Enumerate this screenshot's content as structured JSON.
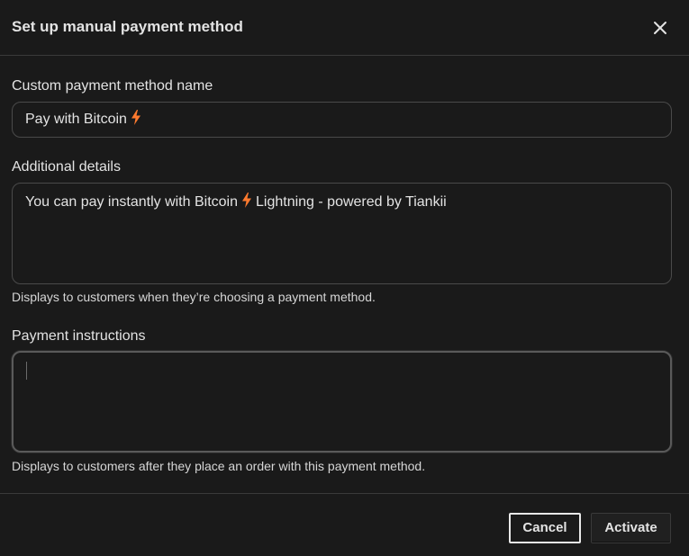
{
  "dialog": {
    "title": "Set up manual payment method",
    "close_icon": "close-icon"
  },
  "name_field": {
    "label": "Custom payment method name",
    "value_prefix": "Pay with Bitcoin",
    "icon": "lightning-bolt-icon"
  },
  "details_field": {
    "label": "Additional details",
    "value_before": "You can pay instantly with Bitcoin",
    "value_after": "Lightning - powered by Tiankii",
    "icon": "lightning-bolt-icon",
    "help": "Displays to customers when they’re choosing a payment method."
  },
  "instructions_field": {
    "label": "Payment instructions",
    "value": "",
    "help": "Displays to customers after they place an order with this payment method."
  },
  "footer": {
    "cancel_label": "Cancel",
    "activate_label": "Activate"
  },
  "colors": {
    "background": "#1a1a1a",
    "text": "#e3e3e3",
    "bolt": "#ff7a2e",
    "border": "#4a4a4a"
  }
}
